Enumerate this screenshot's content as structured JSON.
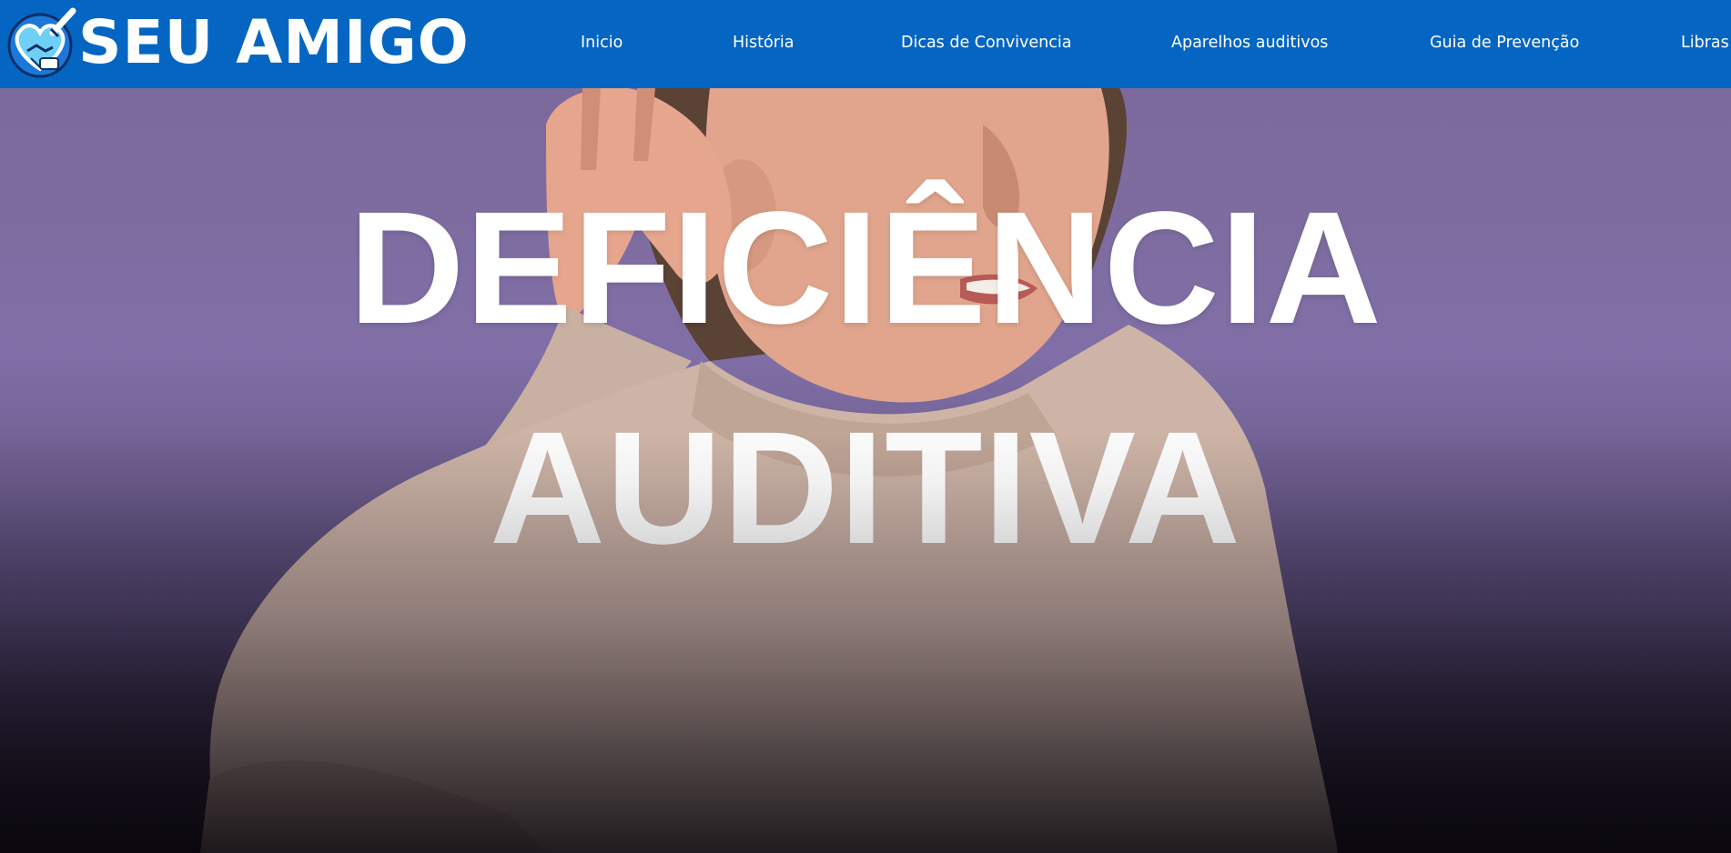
{
  "header": {
    "brand": "SEU AMIGO",
    "logo_icon": "heart-handshake-logo-icon",
    "background_color": "#0466c2",
    "nav": [
      {
        "label": "Inicio"
      },
      {
        "label": "História"
      },
      {
        "label": "Dicas de Convivencia"
      },
      {
        "label": "Aparelhos auditivos"
      },
      {
        "label": "Guia de Prevenção"
      },
      {
        "label": "Libras"
      }
    ]
  },
  "hero": {
    "title_line1": "DEFICIÊNCIA",
    "title_line2": "AUDITIVA",
    "background_color": "#7d6a9c"
  }
}
